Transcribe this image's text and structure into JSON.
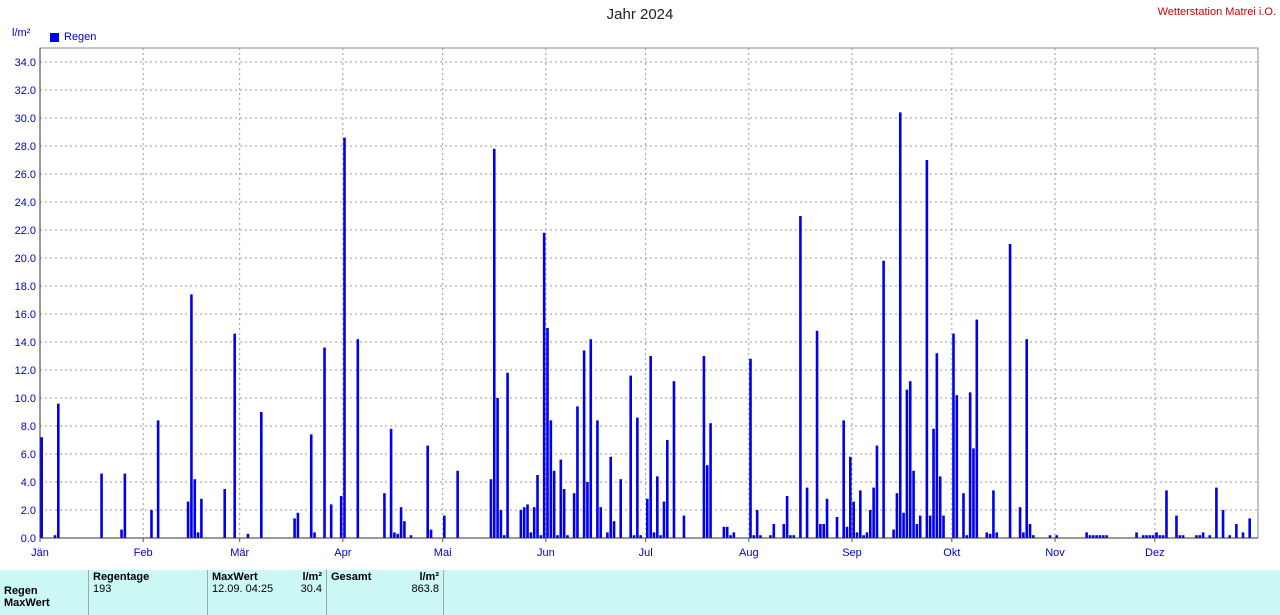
{
  "header": {
    "title": "Jahr 2024",
    "station": "Wetterstation Matrei i.O."
  },
  "colors": {
    "bar": "#0000ee",
    "grid": "#999999",
    "axis_text": "#0000cc"
  },
  "chart_data": {
    "type": "bar",
    "title": "Jahr 2024",
    "ylabel": "l/m²",
    "ylim": [
      0,
      35
    ],
    "yticks": [
      "0.0",
      "2.0",
      "4.0",
      "6.0",
      "8.0",
      "10.0",
      "12.0",
      "14.0",
      "16.0",
      "18.0",
      "20.0",
      "22.0",
      "24.0",
      "26.0",
      "28.0",
      "30.0",
      "32.0",
      "34.0"
    ],
    "months": [
      "Jän",
      "Feb",
      "Mär",
      "Apr",
      "Mai",
      "Jun",
      "Jul",
      "Aug",
      "Sep",
      "Okt",
      "Nov",
      "Dez"
    ],
    "grid": true,
    "legend_position": "top-left",
    "series": [
      {
        "name": "Regen",
        "days": [
          1,
          5,
          6,
          19,
          25,
          26,
          34,
          36,
          45,
          46,
          47,
          48,
          49,
          56,
          59,
          63,
          67,
          77,
          78,
          82,
          83,
          86,
          88,
          91,
          92,
          96,
          104,
          106,
          107,
          108,
          109,
          110,
          112,
          117,
          118,
          122,
          126,
          136,
          137,
          138,
          139,
          140,
          141,
          145,
          146,
          147,
          148,
          149,
          150,
          151,
          152,
          153,
          154,
          155,
          156,
          157,
          158,
          159,
          161,
          162,
          164,
          165,
          166,
          168,
          169,
          171,
          172,
          173,
          175,
          178,
          179,
          180,
          181,
          183,
          184,
          185,
          186,
          187,
          188,
          189,
          191,
          194,
          200,
          201,
          202,
          206,
          207,
          208,
          209,
          214,
          215,
          216,
          217,
          220,
          221,
          224,
          225,
          226,
          227,
          229,
          231,
          234,
          235,
          236,
          237,
          240,
          242,
          243,
          244,
          245,
          246,
          247,
          248,
          249,
          250,
          251,
          252,
          254,
          257,
          258,
          259,
          260,
          261,
          262,
          263,
          264,
          265,
          267,
          268,
          269,
          270,
          271,
          272,
          275,
          276,
          278,
          279,
          280,
          281,
          282,
          285,
          286,
          287,
          288,
          292,
          295,
          296,
          297,
          298,
          299,
          304,
          306,
          315,
          316,
          317,
          318,
          319,
          320,
          321,
          330,
          332,
          333,
          334,
          335,
          336,
          337,
          338,
          339,
          342,
          343,
          344,
          348,
          349,
          350,
          352,
          354,
          356,
          358,
          360,
          362,
          364
        ],
        "values": [
          7.2,
          0.2,
          9.6,
          4.6,
          0.6,
          4.6,
          2.0,
          8.4,
          2.6,
          17.4,
          4.2,
          0.4,
          2.8,
          3.5,
          14.6,
          0.3,
          9.0,
          1.4,
          1.8,
          7.4,
          0.4,
          13.6,
          2.4,
          3.0,
          28.6,
          14.2,
          3.2,
          7.8,
          0.4,
          0.3,
          2.2,
          1.2,
          0.2,
          6.6,
          0.6,
          1.6,
          4.8,
          4.2,
          27.8,
          10.0,
          2.0,
          0.2,
          11.8,
          2.0,
          2.2,
          2.4,
          0.4,
          2.2,
          4.5,
          0.2,
          21.8,
          15.0,
          8.4,
          4.8,
          0.2,
          5.6,
          3.5,
          0.2,
          3.2,
          9.4,
          13.4,
          4.0,
          14.2,
          8.4,
          2.2,
          0.4,
          5.8,
          1.2,
          4.2,
          11.6,
          0.2,
          8.6,
          0.2,
          2.8,
          13.0,
          0.4,
          4.4,
          0.2,
          2.6,
          7.0,
          11.2,
          1.6,
          13.0,
          5.2,
          8.2,
          0.8,
          0.8,
          0.2,
          0.4,
          12.8,
          0.2,
          2.0,
          0.2,
          0.2,
          1.0,
          1.0,
          3.0,
          0.2,
          0.2,
          23.0,
          3.6,
          14.8,
          1.0,
          1.0,
          2.8,
          1.5,
          8.4,
          0.8,
          5.8,
          2.6,
          0.4,
          3.4,
          0.2,
          0.4,
          2.0,
          3.6,
          6.6,
          19.8,
          0.6,
          3.2,
          30.4,
          1.8,
          10.6,
          11.2,
          4.8,
          1.0,
          1.6,
          27.0,
          1.6,
          7.8,
          13.2,
          4.4,
          1.6,
          14.6,
          10.2,
          3.2,
          0.2,
          10.4,
          6.4,
          15.6,
          0.4,
          0.3,
          3.4,
          0.4,
          21.0,
          2.2,
          0.4,
          14.2,
          1.0,
          0.2,
          0.2,
          0.2,
          0.4,
          0.2,
          0.2,
          0.2,
          0.2,
          0.2,
          0.2,
          0.4,
          0.2,
          0.2,
          0.2,
          0.2,
          0.4,
          0.2,
          0.2,
          3.4,
          1.6,
          0.2,
          0.2,
          0.2,
          0.2,
          0.4,
          0.2,
          3.6,
          2.0,
          0.2,
          1.0,
          0.4,
          1.4,
          1.6,
          2.4
        ]
      }
    ]
  },
  "stats": {
    "row_labels": [
      "Regen",
      "MaxWert"
    ],
    "regentage_label": "Regentage",
    "regentage_value": "193",
    "maxwert_label": "MaxWert",
    "unit_label": "l/m²",
    "maxwert_date": "12.09.  04:25",
    "maxwert_value": "30.4",
    "gesamt_label": "Gesamt",
    "gesamt_unit": "l/m²",
    "gesamt_value": "863.8"
  }
}
